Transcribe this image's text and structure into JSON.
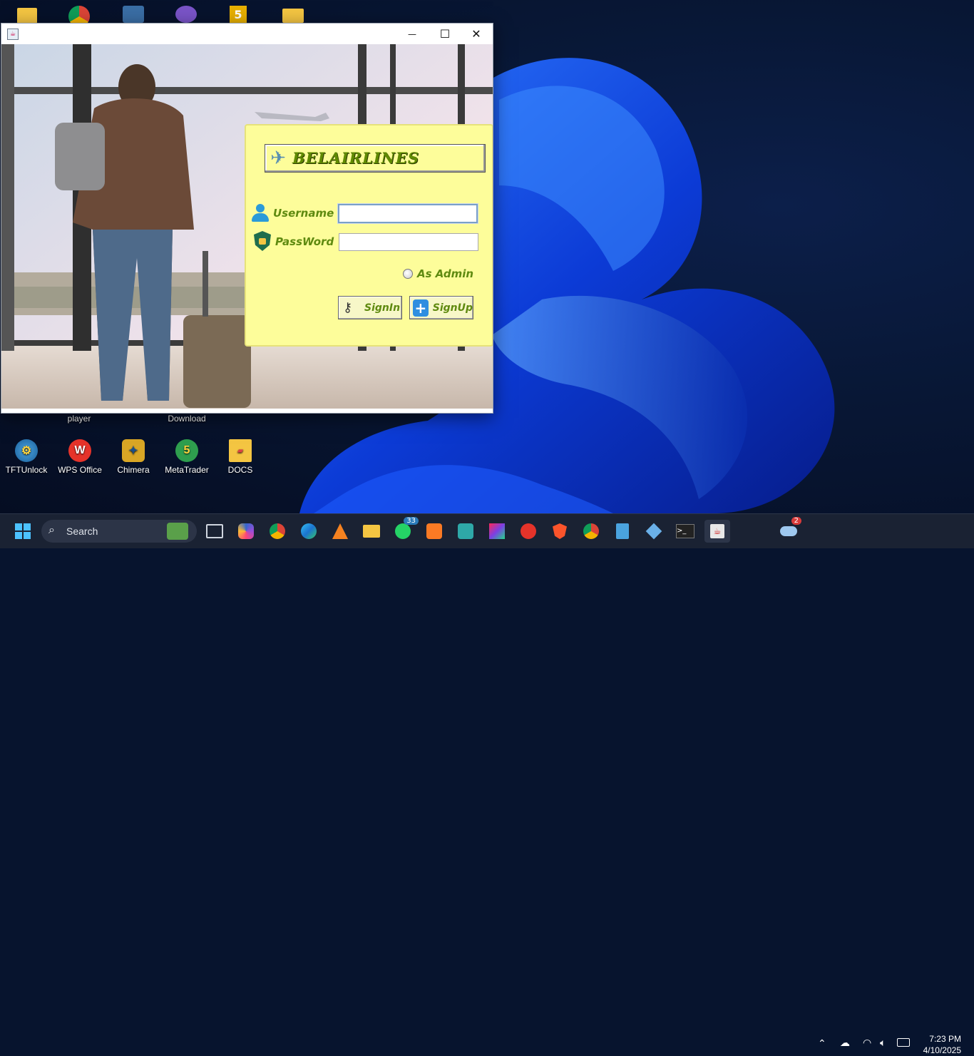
{
  "desktop": {
    "top_icons": [
      {
        "icon": "folder-icon"
      },
      {
        "icon": "chrome-icon"
      },
      {
        "icon": "app-icon"
      },
      {
        "icon": "settings-icon"
      },
      {
        "icon": "html5-icon"
      },
      {
        "icon": "folder-icon"
      }
    ],
    "labels_under_window": {
      "player": "player",
      "download": "Download"
    },
    "icons": [
      {
        "label": "TFTUnlock",
        "icon": "tftunlock-icon"
      },
      {
        "label": "WPS Office",
        "icon": "wps-office-icon"
      },
      {
        "label": "Chimera",
        "icon": "chimera-icon"
      },
      {
        "label": "MetaTrader",
        "icon": "metatrader-icon"
      },
      {
        "label": "DOCS",
        "icon": "folder-icon"
      }
    ]
  },
  "window": {
    "controls": {
      "minimize": "—",
      "maximize": "☐",
      "close": "✕"
    },
    "login": {
      "brand": "BELAIRLINES",
      "username_label": "Username",
      "password_label": "PassWord",
      "username_value": "",
      "password_value": "",
      "admin_label": "As Admin",
      "admin_checked": false,
      "signin_label": "SignIn",
      "signup_label": "SignUp"
    },
    "colors": {
      "panel": "#fdfd9a",
      "label": "#5f8a10"
    }
  },
  "taskbar": {
    "search_placeholder": "Search",
    "whatsapp_badge": "33",
    "weather_badge": "2",
    "time": "7:23 PM",
    "date": "4/10/2025"
  }
}
